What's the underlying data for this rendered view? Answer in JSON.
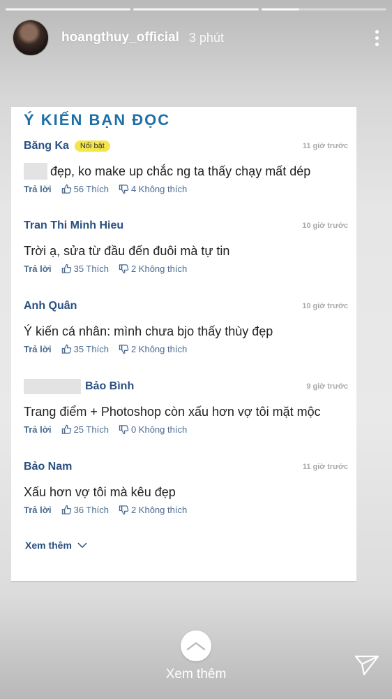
{
  "story": {
    "username": "hoangthuy_official",
    "time": "3 phút",
    "see_more_label": "Xem thêm"
  },
  "card": {
    "title": "Ý KIẾN BẠN ĐỌC",
    "see_more": "Xem thêm",
    "comments": [
      {
        "author": "Băng Ka",
        "badge": "Nổi bật",
        "when": "11 giờ trước",
        "text": "đẹp, ko make up chắc ng ta thấy chạy mất dép",
        "reply": "Trả lời",
        "likes": "56 Thích",
        "dislikes": "4 Không thích"
      },
      {
        "author": "Tran Thi Minh Hieu",
        "when": "10 giờ trước",
        "text": "Trời ạ, sửa từ đầu đến đuôi mà tự tin",
        "reply": "Trả lời",
        "likes": "35 Thích",
        "dislikes": "2 Không thích"
      },
      {
        "author": "Anh Quân",
        "when": "10 giờ trước",
        "text": "Ý kiến cá nhân: mình chưa bjo thấy thùy đẹp",
        "reply": "Trả lời",
        "likes": "35 Thích",
        "dislikes": "2 Không thích"
      },
      {
        "author": "Bảo Bình",
        "when": "9 giờ trước",
        "text": "Trang điểm + Photoshop còn xấu hơn vợ tôi mặt mộc",
        "reply": "Trả lời",
        "likes": "25 Thích",
        "dislikes": "0 Không thích"
      },
      {
        "author": "Bảo Nam",
        "when": "11 giờ trước",
        "text": "Xấu hơn vợ tôi mà kêu đẹp",
        "reply": "Trả lời",
        "likes": "36 Thích",
        "dislikes": "2 Không thích"
      }
    ]
  },
  "icons": [
    "more-vert-icon",
    "thumb-up-icon",
    "thumb-down-icon",
    "chevron-down-icon",
    "chevron-up-icon",
    "send-icon"
  ],
  "colors": {
    "title": "#1e6fa6",
    "author": "#2a5080",
    "badge": "#f4e64a"
  }
}
